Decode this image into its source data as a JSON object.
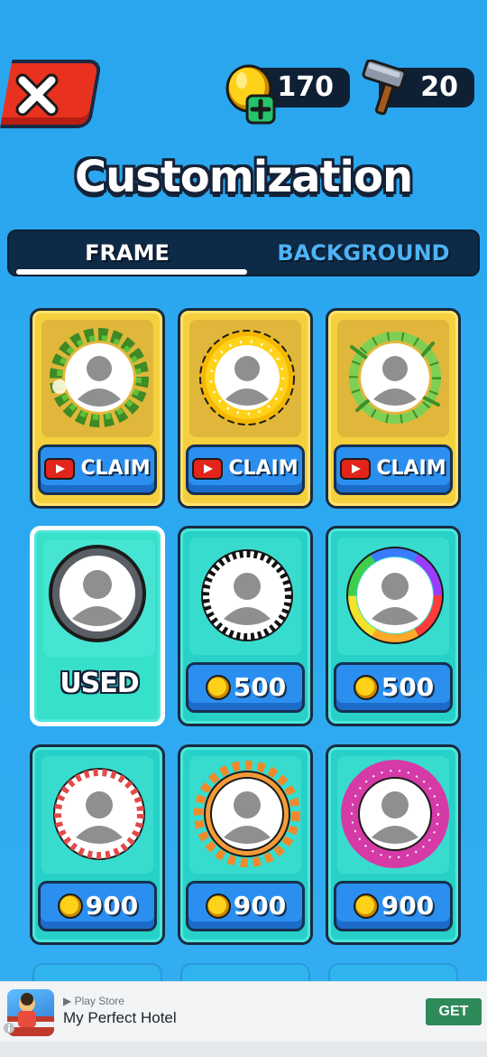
{
  "header": {
    "coins": "170",
    "hammers": "20"
  },
  "title": "Customization",
  "tabs": [
    {
      "label": "FRAME",
      "active": true
    },
    {
      "label": "BACKGROUND",
      "active": false
    }
  ],
  "cards": [
    {
      "frame": "laurel-wreath",
      "action": "CLAIM"
    },
    {
      "frame": "golden-sun",
      "action": "CLAIM"
    },
    {
      "frame": "bamboo",
      "action": "CLAIM"
    },
    {
      "frame": "default-gray",
      "status": "USED"
    },
    {
      "frame": "checkered",
      "price": "500"
    },
    {
      "frame": "rainbow",
      "price": "500"
    },
    {
      "frame": "candy-cane",
      "price": "900"
    },
    {
      "frame": "orange-gear",
      "price": "900"
    },
    {
      "frame": "pink-scalloped",
      "price": "900"
    }
  ],
  "ad": {
    "store": "Play Store",
    "title": "My Perfect Hotel",
    "cta": "GET"
  },
  "colors": {
    "background": "#2aa8f0",
    "close_button": "#e8321f",
    "button_blue": "#2b8ff0",
    "card_gold": "#f4d03f",
    "card_teal": "#27d1c7",
    "ad_cta": "#2f8a5a"
  }
}
